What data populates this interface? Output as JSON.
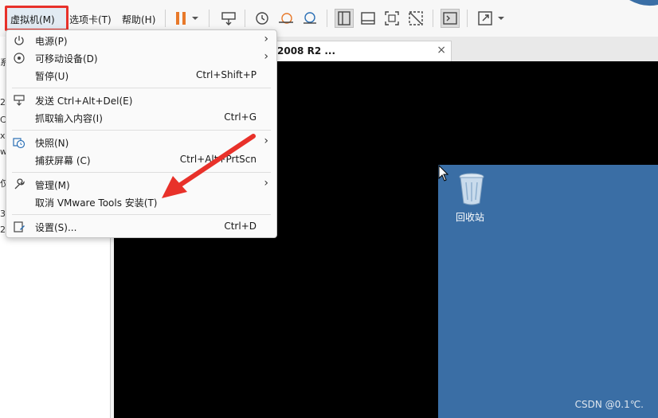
{
  "menubar": {
    "vm_label": "虚拟机(M)",
    "tabs_label": "选项卡(T)",
    "help_label": "帮助(H)"
  },
  "toolbar": {
    "icons": [
      "pause-icon",
      "dropdown-arrow-icon",
      "send-ctrl-alt-del-icon",
      "snapshot-icon",
      "revert-snapshot-icon",
      "snapshot-manager-icon",
      "library-view-icon",
      "console-view-icon",
      "fullscreen-icon",
      "unity-icon",
      "terminal-icon",
      "stretch-icon",
      "dropdown-arrow-icon"
    ],
    "accent_pause": "#e8792a"
  },
  "tab": {
    "title": "2008 R2 ...",
    "close": "×"
  },
  "library_fragments": [
    "系",
    "2.",
    "C",
    "x",
    "w",
    "仅",
    "3",
    "2"
  ],
  "vm_menu": {
    "items": [
      {
        "label": "电源(P)",
        "shortcut": "",
        "submenu": "›",
        "icon": "power-icon"
      },
      {
        "label": "可移动设备(D)",
        "shortcut": "",
        "submenu": "›",
        "icon": "removable-device-icon"
      },
      {
        "label": "暂停(U)",
        "shortcut": "Ctrl+Shift+P",
        "submenu": "",
        "icon": ""
      },
      {
        "label": "发送 Ctrl+Alt+Del(E)",
        "shortcut": "",
        "submenu": "",
        "icon": "keyboard-send-icon"
      },
      {
        "label": "抓取输入内容(I)",
        "shortcut": "Ctrl+G",
        "submenu": "",
        "icon": ""
      },
      {
        "label": "快照(N)",
        "shortcut": "",
        "submenu": "›",
        "icon": "snapshot-icon"
      },
      {
        "label": "捕获屏幕 (C)",
        "shortcut": "Ctrl+Alt+PrtScn",
        "submenu": "",
        "icon": ""
      },
      {
        "label": "管理(M)",
        "shortcut": "",
        "submenu": "›",
        "icon": "wrench-icon"
      },
      {
        "label": "取消 VMware Tools 安装(T)",
        "shortcut": "",
        "submenu": "",
        "icon": ""
      },
      {
        "label": "设置(S)...",
        "shortcut": "Ctrl+D",
        "submenu": "",
        "icon": "settings-icon"
      }
    ]
  },
  "guest": {
    "recycle_bin_label": "回收站",
    "desktop_color": "#3a6ea5"
  },
  "watermark": "CSDN @0.1℃.",
  "colors": {
    "highlight_red": "#e8312a",
    "annotation_red": "#e8312a"
  }
}
